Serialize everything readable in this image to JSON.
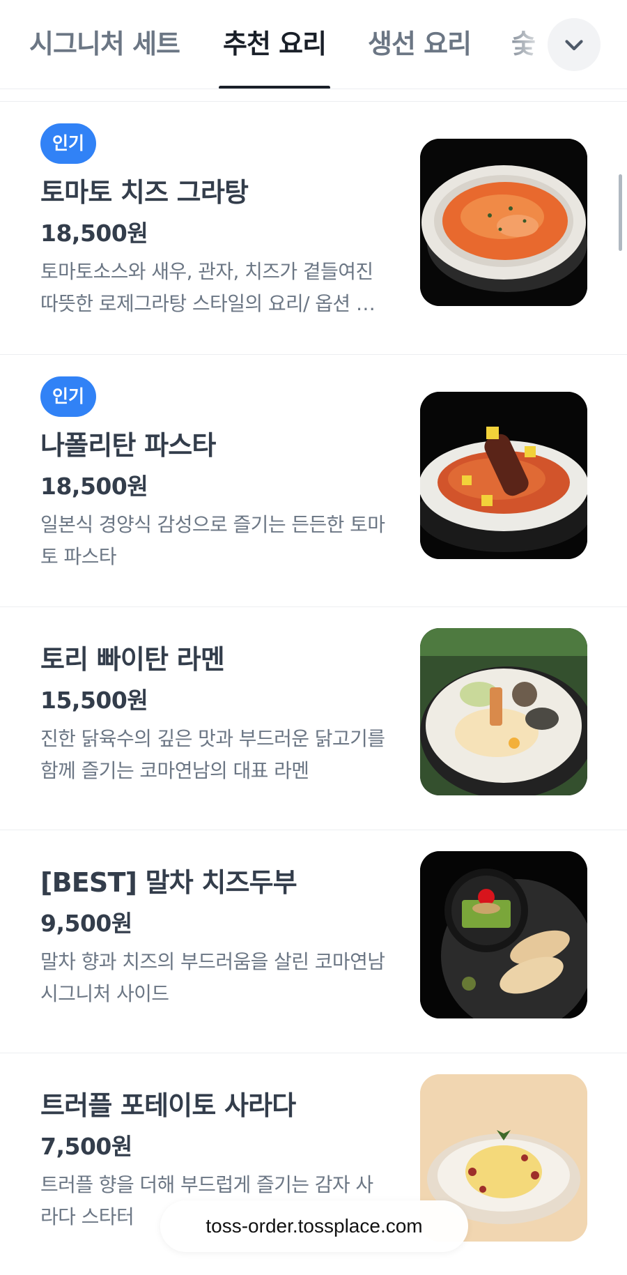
{
  "tabs": [
    {
      "label": "시그니처 세트"
    },
    {
      "label": "추천 요리"
    },
    {
      "label": "생선 요리"
    },
    {
      "label": "숯"
    }
  ],
  "active_tab_index": 1,
  "dropdown_icon": "chevron-down-icon",
  "items": [
    {
      "badge": "인기",
      "name": "토마토 치즈 그라탕",
      "price": "18,500원",
      "description": "토마토소스와 새우, 관자, 치즈가 곁들여진 따뜻한 로제그라탕 스타일의 요리/ 옵션 선택 가능",
      "image": "tomato-gratin-photo"
    },
    {
      "badge": "인기",
      "name": "나폴리탄 파스타",
      "price": "18,500원",
      "description": "일본식 경양식 감성으로 즐기는 든든한 토마토 파스타",
      "image": "napolitan-pasta-photo"
    },
    {
      "name": "토리 빠이탄 라멘",
      "price": "15,500원",
      "description": "진한 닭육수의 깊은 맛과 부드러운 닭고기를 함께 즐기는 코마연남의 대표 라멘",
      "image": "tori-paitan-ramen-photo"
    },
    {
      "name": "[BEST] 말차 치즈두부",
      "price": "9,500원",
      "description": "말차 향과 치즈의 부드러움을 살린 코마연남 시그니처 사이드",
      "image": "matcha-cheese-tofu-photo"
    },
    {
      "name": "트러플 포테이토 사라다",
      "price": "7,500원",
      "description": "트러플 향을 더해 부드럽게 즐기는 감자 사라다 스타터",
      "image": "truffle-potato-salad-photo"
    }
  ],
  "url_bar": {
    "text": "toss-order.tossplace.com"
  },
  "colors": {
    "accent": "#3182f6",
    "text_primary": "#333d4b",
    "text_secondary": "#6b7684"
  }
}
